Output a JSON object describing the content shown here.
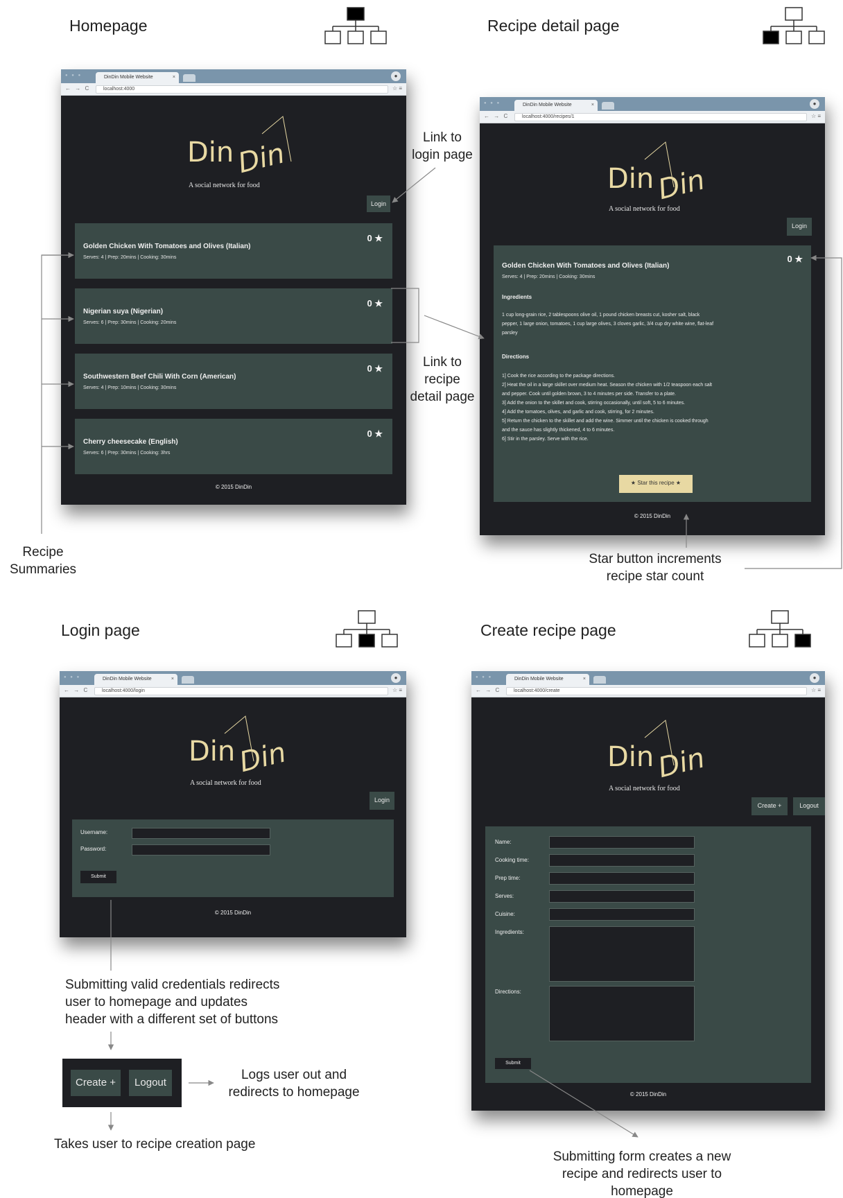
{
  "sections": {
    "home": "Homepage",
    "detail": "Recipe detail page",
    "login": "Login page",
    "create": "Create recipe page"
  },
  "browser": {
    "tab_title": "DinDin Mobile Website",
    "url_home": "localhost:4000",
    "url_detail": "localhost:4000/recipes/1",
    "url_login": "localhost:4000/login",
    "url_create": "localhost:4000/create"
  },
  "site": {
    "logo_part1": "Din",
    "logo_part2": "Din",
    "tagline": "A social network for food",
    "login_button": "Login",
    "create_button": "Create +",
    "logout_button": "Logout",
    "footer": "© 2015 DinDin"
  },
  "recipes": [
    {
      "title": "Golden Chicken With Tomatoes and Olives (Italian)",
      "meta": "Serves: 4 | Prep: 20mins | Cooking: 30mins",
      "stars": "0 ★"
    },
    {
      "title": "Nigerian suya (Nigerian)",
      "meta": "Serves: 6 | Prep: 30mins | Cooking: 20mins",
      "stars": "0 ★"
    },
    {
      "title": "Southwestern Beef Chili With Corn (American)",
      "meta": "Serves: 4 | Prep: 10mins | Cooking: 30mins",
      "stars": "0 ★"
    },
    {
      "title": "Cherry cheesecake (English)",
      "meta": "Serves: 6 | Prep: 30mins | Cooking: 3hrs",
      "stars": "0 ★"
    }
  ],
  "detail": {
    "title": "Golden Chicken With Tomatoes and Olives (Italian)",
    "meta": "Serves: 4 | Prep: 20mins | Cooking: 30mins",
    "stars": "0 ★",
    "ingredients_heading": "Ingredients",
    "ingredients": [
      "1 cup long-grain rice, 2 tablespoons olive oil, 1 pound chicken breasts cut, kosher salt, black",
      "pepper, 1 large onion, tomatoes, 1 cup large olives, 3 cloves garlic, 3/4 cup dry white wine, flat-leaf",
      "parsley"
    ],
    "directions_heading": "Directions",
    "directions": [
      "1] Cook the rice according to the package directions.",
      "2] Heat the oil in a large skillet over medium heat. Season the chicken with 1/2 teaspoon each salt",
      "and pepper. Cook until golden brown, 3 to 4 minutes per side. Transfer to a plate.",
      "3] Add the onion to the skillet and cook, stirring occasionally, until soft, 5 to 6 minutes.",
      "4] Add the tomatoes, olives, and garlic and cook, stirring, for 2 minutes.",
      "5] Return the chicken to the skillet and add the wine. Simmer until the chicken is cooked through",
      "and the sauce has slightly thickened, 4 to 6 minutes.",
      "6] Stir in the parsley. Serve with the rice."
    ],
    "star_button": "★ Star this recipe ★"
  },
  "login_form": {
    "username_label": "Username:",
    "password_label": "Password:",
    "submit": "Submit"
  },
  "create_form": {
    "name": "Name:",
    "cooking_time": "Cooking time:",
    "prep_time": "Prep time:",
    "serves": "Serves:",
    "cuisine": "Cuisine:",
    "ingredients": "Ingredients:",
    "directions": "Directions:",
    "submit": "Submit"
  },
  "annotations": {
    "link_login": [
      "Link to",
      "login page"
    ],
    "link_recipe": [
      "Link to",
      "recipe",
      "detail page"
    ],
    "recipe_summaries": [
      "Recipe",
      "Summaries"
    ],
    "star_button": [
      "Star button increments",
      "recipe star count"
    ],
    "submitting_credentials": [
      "Submitting valid credentials redirects",
      "user to homepage and updates",
      "header with a different set of buttons"
    ],
    "logs_out": [
      "Logs user out and",
      "redirects to homepage"
    ],
    "takes_user": "Takes user to recipe creation page",
    "submitting_form": [
      "Submitting form creates a new",
      "recipe and redirects user to",
      "homepage"
    ]
  },
  "colors": {
    "page_bg": "#1e1f23",
    "panel": "#3a4a47",
    "accent": "#e8d9a3",
    "chrome": "#7a95ab"
  }
}
